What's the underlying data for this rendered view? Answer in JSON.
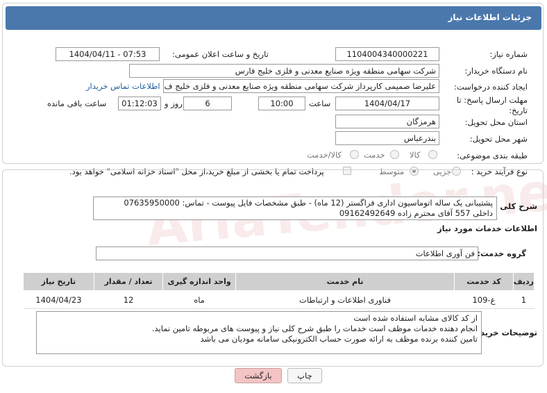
{
  "header": {
    "title": "جزئیات اطلاعات نیاز"
  },
  "form": {
    "need_number_label": "شماره نیاز:",
    "need_number": "1104004340000221",
    "announce_label": "تاریخ و ساعت اعلان عمومی:",
    "announce_value": "1404/04/11 - 07:53",
    "buyer_org_label": "نام دستگاه خریدار:",
    "buyer_org": "شرکت سهامی منطقه ویژه صنایع معدنی و فلزی خلیج فارس",
    "creator_label": "ایجاد کننده درخواست:",
    "creator": "علیرضا صمیمی کارپرداز شرکت سهامی منطقه ویژه صنایع معدنی و فلزی خلیج ف",
    "contact_link": "اطلاعات تماس خریدار",
    "deadline_label_1": "مهلت ارسال پاسخ: تا",
    "deadline_label_2": "تاریخ:",
    "deadline_date": "1404/04/17",
    "time_label": "ساعت",
    "deadline_time": "10:00",
    "days_value": "6",
    "days_label": "روز و",
    "remaining_time": "01:12:03",
    "remaining_label": "ساعت باقی مانده",
    "province_label": "استان محل تحویل:",
    "province": "هرمزگان",
    "city_label": "شهر محل تحویل:",
    "city": "بندرعباس",
    "category_label": "طبقه بندی موضوعی:",
    "category_options": [
      "کالا",
      "خدمت",
      "کالا/خدمت"
    ],
    "category_selected": "خدمت",
    "process_label": "نوع فرآیند خرید :",
    "process_options": [
      "جزیی",
      "متوسط"
    ],
    "process_selected": "متوسط",
    "payment_text": "پرداخت تمام یا بخشی از مبلغ خرید،از محل \"اسناد خزانه اسلامی\" خواهد بود."
  },
  "description": {
    "label": "شرح کلی نیاز:",
    "line1": "پشتیبانی یک ساله اتوماسیون اداری فراگستر (12 ماه) - طبق مشخصات فایل پیوست - تماس: 07635950000",
    "line2": "داخلی 557 آقای محترم زاده 09162492649"
  },
  "services": {
    "section_title": "اطلاعات خدمات مورد نیاز",
    "group_label": "گروه خدمت:",
    "group_value": "فن آوری اطلاعات",
    "columns": [
      "ردیف",
      "کد خدمت",
      "نام خدمت",
      "واحد اندازه گیری",
      "تعداد / مقدار",
      "تاریخ نیاز"
    ],
    "rows": [
      {
        "index": "1",
        "code": "غ-109",
        "name": "فناوری اطلاعات و ارتباطات",
        "unit": "ماه",
        "qty": "12",
        "date": "1404/04/23"
      }
    ]
  },
  "buyer_notes": {
    "label": "توضیحات خریدار:",
    "line1": "از کد کالای مشابه استفاده شده است",
    "line2": "انجام دهنده خدمات موظف است خدمات را طبق شرح کلی نیاز و پیوست های مربوطه تامین نماید.",
    "line3": "تامین کننده برنده موظف به ارائه صورت حساب الکترونیکی سامانه مودیان می باشد"
  },
  "buttons": {
    "print": "چاپ",
    "back": "بازگشت"
  },
  "watermark": "AriaTender.net"
}
